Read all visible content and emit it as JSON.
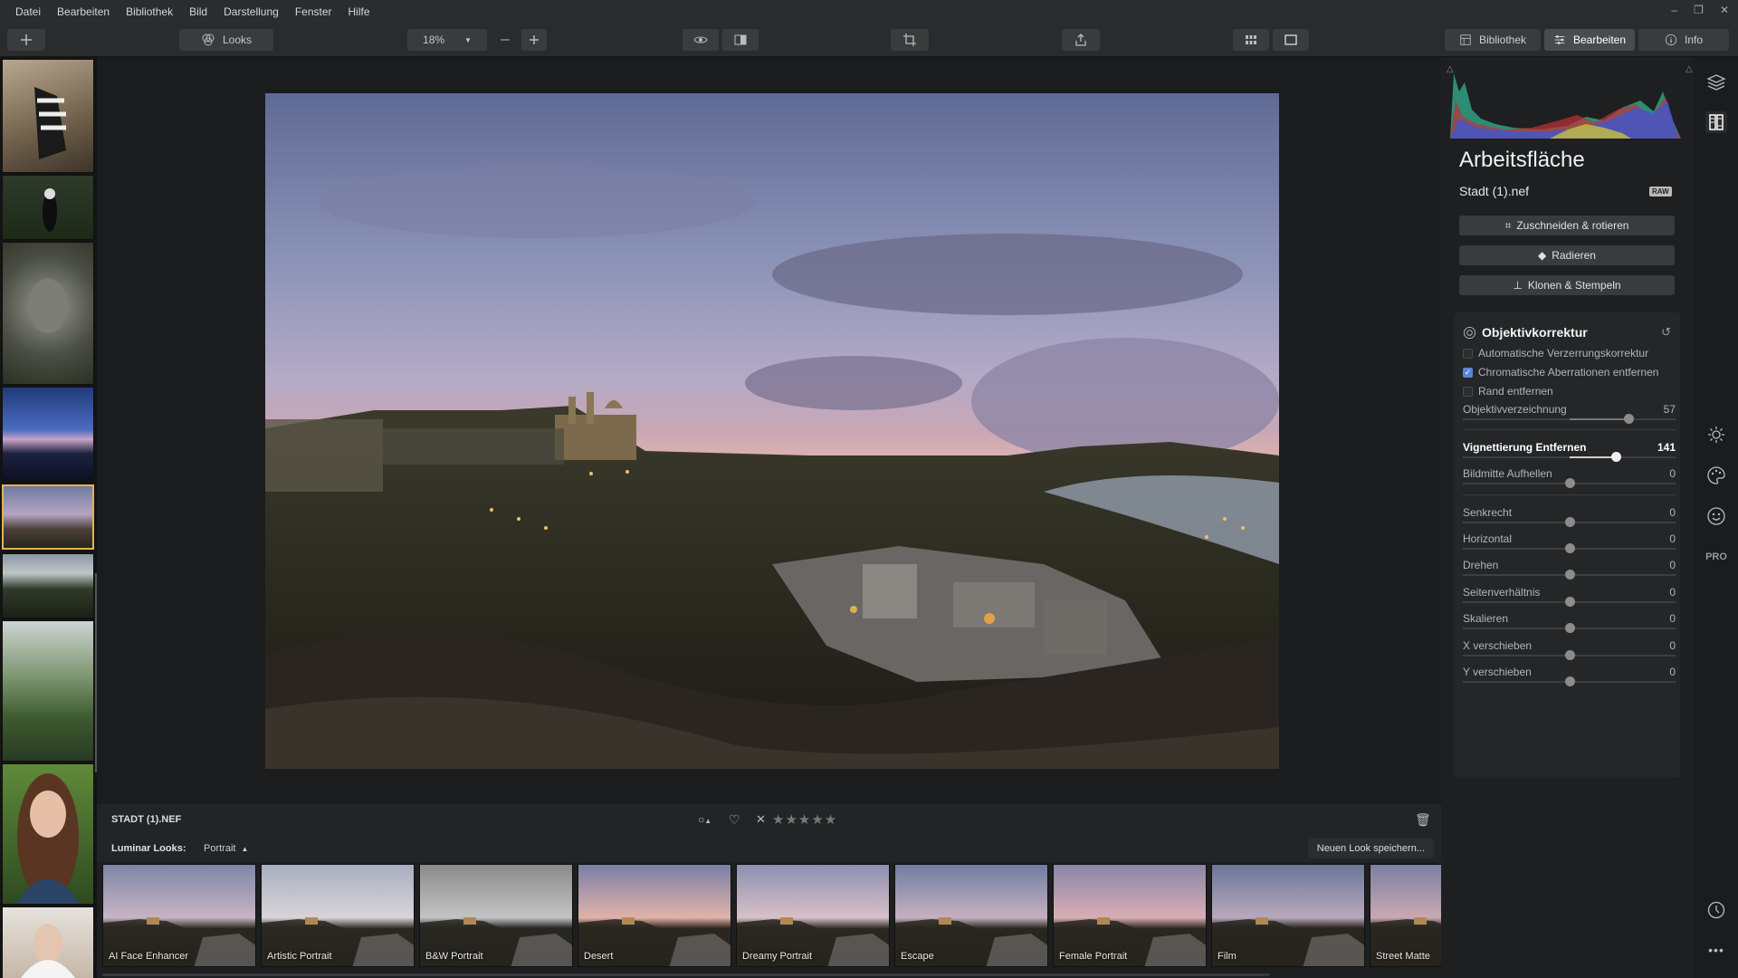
{
  "menu": [
    "Datei",
    "Bearbeiten",
    "Bibliothek",
    "Bild",
    "Darstellung",
    "Fenster",
    "Hilfe"
  ],
  "toolbar": {
    "looks_label": "Looks",
    "zoom_value": "18%",
    "tabs": {
      "library": "Bibliothek",
      "edit": "Bearbeiten",
      "info": "Info"
    }
  },
  "image": {
    "filename_caps": "STADT (1).NEF"
  },
  "looks_bar": {
    "label": "Luminar Looks:",
    "category": "Portrait",
    "save_label": "Neuen Look speichern..."
  },
  "looks": [
    {
      "name": "AI Face Enhancer"
    },
    {
      "name": "Artistic Portrait"
    },
    {
      "name": "B&W Portrait"
    },
    {
      "name": "Desert"
    },
    {
      "name": "Dreamy Portrait"
    },
    {
      "name": "Escape"
    },
    {
      "name": "Female Portrait"
    },
    {
      "name": "Film"
    },
    {
      "name": "Street Matte"
    }
  ],
  "panel": {
    "title": "Arbeitsfläche",
    "filename": "Stadt (1).nef",
    "raw_badge": "RAW",
    "tools": {
      "crop": "Zuschneiden & rotieren",
      "erase": "Radieren",
      "clone": "Klonen & Stempeln"
    }
  },
  "lens": {
    "title": "Objektivkorrektur",
    "checks": [
      {
        "label": "Automatische Verzerrungskorrektur",
        "checked": false
      },
      {
        "label": "Chromatische Aberrationen entfernen",
        "checked": true
      },
      {
        "label": "Rand entfernen",
        "checked": false
      }
    ],
    "sliders": [
      {
        "name": "Objektivverzeichnung",
        "value": "57",
        "pos": 0.78
      },
      {
        "name": "Vignettierung Entfernen",
        "value": "141",
        "pos": 0.72
      },
      {
        "name": "Bildmitte Aufhellen",
        "value": "0",
        "pos": 0.5
      },
      {
        "name": "Senkrecht",
        "value": "0",
        "pos": 0.5
      },
      {
        "name": "Horizontal",
        "value": "0",
        "pos": 0.5
      },
      {
        "name": "Drehen",
        "value": "0",
        "pos": 0.5
      },
      {
        "name": "Seitenverhältnis",
        "value": "0",
        "pos": 0.5
      },
      {
        "name": "Skalieren",
        "value": "0",
        "pos": 0.5
      },
      {
        "name": "X verschieben",
        "value": "0",
        "pos": 0.5
      },
      {
        "name": "Y verschieben",
        "value": "0",
        "pos": 0.5
      }
    ]
  },
  "right_icons": {
    "pro": "PRO"
  },
  "colors": {
    "accent": "#5b84d8",
    "selection": "#e2b44a"
  }
}
